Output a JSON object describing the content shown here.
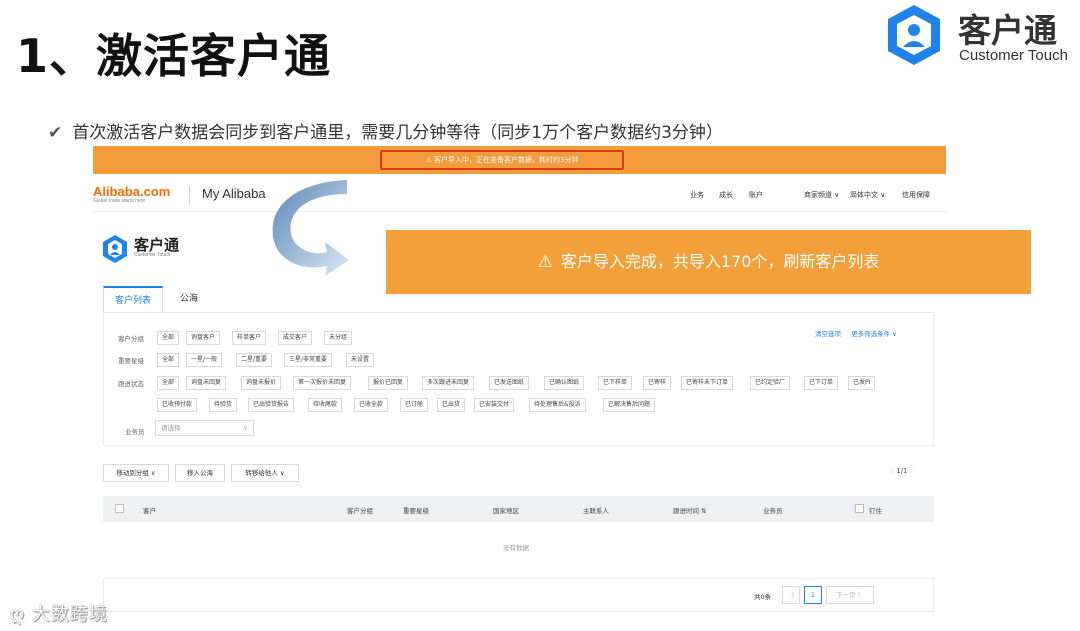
{
  "slide": {
    "title": "1、激活客户通",
    "bullet": "首次激活客户数据会同步到客户通里，需要几分钟等待（同步1万个客户数据约3分钟）",
    "bullet_icon": "check-icon"
  },
  "brand": {
    "name": "客户通",
    "subtitle": "Customer Touch",
    "color": "#1f83ea"
  },
  "screenshot": {
    "banner_notice": "客户导入中，正在准备客户数据，耗时约3分钟",
    "logo_name": "Alibaba.com",
    "logo_tagline": "Global trade starts here.",
    "site_title": "My Alibaba",
    "top_nav": [
      "业务",
      "成长",
      "账户",
      "商家频道 ∨",
      "简体中文 ∨",
      "信用保障"
    ],
    "app_name": "客户通",
    "app_sub": "Customer Touch",
    "tabs": [
      "客户列表",
      "公海"
    ],
    "filters": {
      "group_label": "客户分组",
      "group_chips": [
        "全部",
        "询盘客户",
        "样单客户",
        "成交客户",
        "未分组"
      ],
      "star_label": "重要星级",
      "star_chips": [
        "全部",
        "一星/一般",
        "二星/重要",
        "三星/非常重要",
        "未设置"
      ],
      "status_label": "跟进状态",
      "status_chips_1": [
        "全部",
        "询盘未回复",
        "询盘未报价",
        "第一次报价未回复",
        "报价已回复",
        "多次跟进未回复",
        "已发送图纸",
        "已确认图纸",
        "已下样单",
        "已寄样",
        "已寄样未下订单",
        "已约定验厂",
        "已下订单",
        "已发PI"
      ],
      "status_chips_2": [
        "已收预付款",
        "待验货",
        "已出验货报告",
        "待收尾款",
        "已收全款",
        "已订舱",
        "已出货",
        "已安装交付",
        "待处理售后&投诉",
        "已解决售后问题"
      ],
      "staff_label": "业务员",
      "staff_placeholder": "请选择",
      "clear_link": "清空选项",
      "more_link": "更多筛选条件 ∨"
    },
    "actions": [
      "移动到分组 ∨",
      "移入公海",
      "转移给他人 ∨"
    ],
    "pager_top": "1/1",
    "columns": [
      "客户",
      "客户分组",
      "重要星级",
      "国家地区",
      "主联系人",
      "跟进时间 ⇅",
      "业务员",
      "钉住"
    ],
    "empty_text": "没有数据",
    "pager_bottom": {
      "total": "共0条",
      "current_page": "1",
      "next": "下一页"
    }
  },
  "toast": {
    "icon": "warning-icon",
    "text": "客户导入完成，共导入170个，刷新客户列表",
    "color": "#f3a03a"
  },
  "watermark": "大数跨境"
}
